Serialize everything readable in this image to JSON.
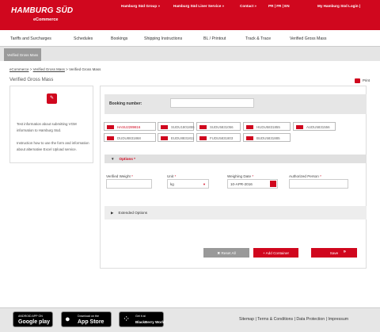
{
  "header": {
    "logo": "HAMBURG SÜD",
    "logo_sub": "eCommerce",
    "nav": [
      "Hamburg Süd Group »",
      "Hamburg Süd Liner Service »",
      "Contact »",
      "PR | FR | EN",
      "My Hamburg Süd Login |"
    ]
  },
  "main_nav": [
    "Tariffs and Surcharges",
    "Schedules",
    "Bookings",
    "Shipping Instructions",
    "BL / Printout",
    "Track & Trace",
    "Verified Gross Mass"
  ],
  "sub_nav": {
    "active": "Verified Gross Mass"
  },
  "breadcrumb": {
    "link1": "eCommerce",
    "sep": " > ",
    "link2": "Verified Gross Mass",
    "current": "Verified Gross Mass"
  },
  "page_title": "Verified Gross Mass",
  "print_label": "Print",
  "sidebar": {
    "p1": "Test information about submitting VGM information to Hamburg Süd.",
    "p2": "Instruction how to use the form and information about alternative Excel Upload service."
  },
  "booking": {
    "label": "Booking number:",
    "value": ""
  },
  "containers": [
    {
      "id": "HASU2289816",
      "active": true
    },
    {
      "id": "SUDU1801855",
      "active": false
    },
    {
      "id": "SUDU5831056",
      "active": false
    },
    {
      "id": "HUDU5831855",
      "active": false
    },
    {
      "id": "AUDU5831556",
      "active": false
    },
    {
      "id": "DUDU8831868",
      "active": false
    },
    {
      "id": "EUDU8831811",
      "active": false
    },
    {
      "id": "FUDU5831803",
      "active": false
    },
    {
      "id": "BUDU5831885",
      "active": false
    }
  ],
  "options": {
    "toggle": "▼",
    "label": "Options *"
  },
  "form": {
    "verified_weight_label": "Verified Weight",
    "unit_label": "Unit",
    "weighing_date_label": "Weighing Date",
    "authorized_person_label": "Authorized Person",
    "req": "*",
    "verified_weight_value": "",
    "unit_value": "kg",
    "weighing_date_value": "10-APR-2016",
    "authorized_person_value": ""
  },
  "extended": {
    "toggle": "▶",
    "label": "Extended Options"
  },
  "buttons": {
    "reset": "✖ Reset All",
    "add": "+ Add Container",
    "save": "Save",
    "save_arrows": "»"
  },
  "stores": [
    {
      "small": "ANDROID APP ON",
      "big": "Google play",
      "icon": "google-play-icon"
    },
    {
      "small": "Download on the",
      "big": "App Store",
      "icon": "apple-icon"
    },
    {
      "small": "Get it at",
      "big": "BlackBerry World",
      "icon": "blackberry-icon"
    }
  ],
  "footer": {
    "sitemap": "Sitemap",
    "terms": "Terms & Conditions",
    "privacy": "Data Protection",
    "imprint": "Impressum",
    "sep": " | "
  },
  "colors": {
    "brand_red": "#d0071e",
    "grey_bar": "#e6e6e6"
  }
}
